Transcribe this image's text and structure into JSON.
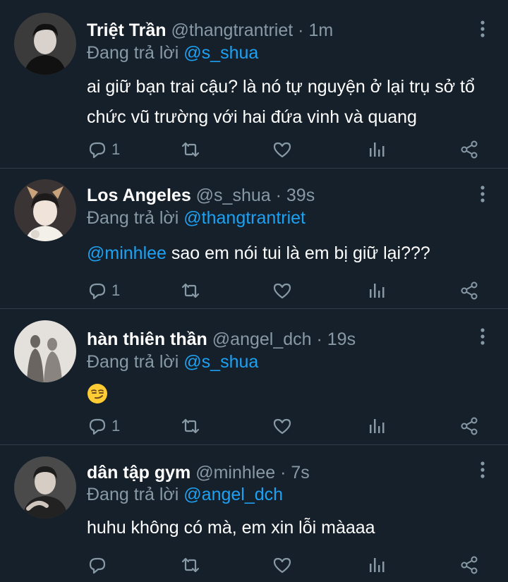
{
  "tweets": [
    {
      "display_name": "Triệt Trần",
      "handle": "@thangtrantriet",
      "separator": "·",
      "time": "1m",
      "reply_prefix": "Đang trả lời",
      "reply_to": "@s_shua",
      "text": "ai giữ bạn trai cậu? là nó tự nguyện ở lại trụ sở tổ chức vũ trường với hai đứa vinh và quang",
      "reply_count": "1"
    },
    {
      "display_name": "Los Angeles",
      "handle": "@s_shua",
      "separator": "·",
      "time": "39s",
      "reply_prefix": "Đang trả lời",
      "reply_to": "@thangtrantriet",
      "text_mention": "@minhlee",
      "text": " sao em nói tui là em bị giữ lại???",
      "reply_count": "1"
    },
    {
      "display_name": "hàn thiên thần",
      "handle": "@angel_dch",
      "separator": "·",
      "time": "19s",
      "reply_prefix": "Đang trả lời",
      "reply_to": "@s_shua",
      "emoji": "smirk",
      "reply_count": "1"
    },
    {
      "display_name": "dân tập gym",
      "handle": "@minhlee",
      "separator": "·",
      "time": "7s",
      "reply_prefix": "Đang trả lời",
      "reply_to": "@angel_dch",
      "text": "huhu không có mà, em xin lỗi màaaa",
      "reply_count": ""
    }
  ],
  "icons": {
    "reply": "reply-icon",
    "retweet": "retweet-icon",
    "like": "heart-icon",
    "analytics": "analytics-icon",
    "share": "share-icon",
    "more": "more-vertical-icon"
  },
  "colors": {
    "background": "#15202b",
    "text_secondary": "#8899a6",
    "accent": "#1da1f2",
    "divider": "#2f3b47"
  }
}
